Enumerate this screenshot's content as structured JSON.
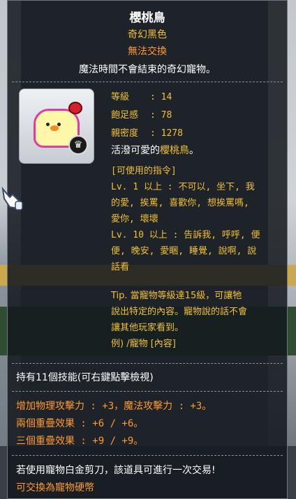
{
  "item": {
    "name": "櫻桃鳥",
    "type": "奇幻黑色",
    "trade": "無法交換",
    "description": "魔法時間不會結束的奇幻寵物。"
  },
  "stats": [
    {
      "label": "等級",
      "value": "14"
    },
    {
      "label": "飽足感",
      "value": "78"
    },
    {
      "label": "親密度",
      "value": "1278"
    }
  ],
  "flavor": {
    "prefix": "活潑可愛的",
    "highlight": "櫻桃鳥",
    "suffix": "。"
  },
  "commands": {
    "header": "[可使用的指令]",
    "lines": [
      "Lv. 1 以上 : 不可以, 坐下, 我",
      "的愛, 挨罵, 喜歡你, 想挨罵嗎,",
      "愛你, 壞壞",
      "Lv. 10 以上 : 告訴我, 呼呼, 便",
      "便, 晚安, 愛睏, 睡覺, 說啊, 說",
      "話看"
    ]
  },
  "tip": {
    "lines": [
      "Tip. 當寵物等級達15級，可讓牠",
      "說出特定的內容。寵物說的話不會",
      "讓其他玩家看到。",
      "例) /寵物 [內容]"
    ]
  },
  "skills_text": "持有11個技能(可右鍵點擊檢視)",
  "bonuses": [
    "增加物理攻擊力 : +3，魔法攻擊力 : +3。",
    "兩個重疊效果 : +6 / +6。",
    "三個重疊效果 : +9 / +9。"
  ],
  "footer": {
    "line1": "若使用寵物白金剪刀，該道具可進行一次交易!",
    "line2": "可交換為寵物硬幣"
  },
  "colors": {
    "yellow": "#f2c12e",
    "orange": "#ff9a2b",
    "white": "#ffffff",
    "panel": "#14181e"
  }
}
